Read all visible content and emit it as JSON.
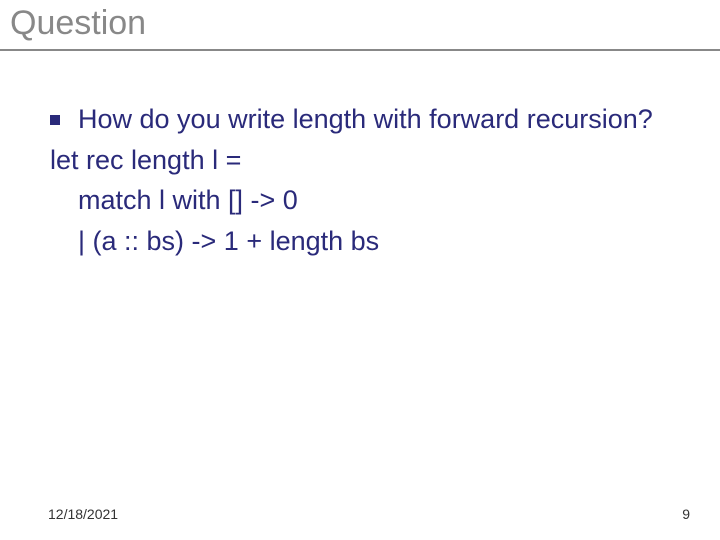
{
  "title": "Question",
  "bullet_text": "How do you write length with forward recursion?",
  "code": {
    "line1": "let rec length l =",
    "line2": "match l with [] -> 0",
    "line3": "| (a :: bs) -> 1 + length bs"
  },
  "footer": {
    "date": "12/18/2021",
    "page": "9"
  }
}
